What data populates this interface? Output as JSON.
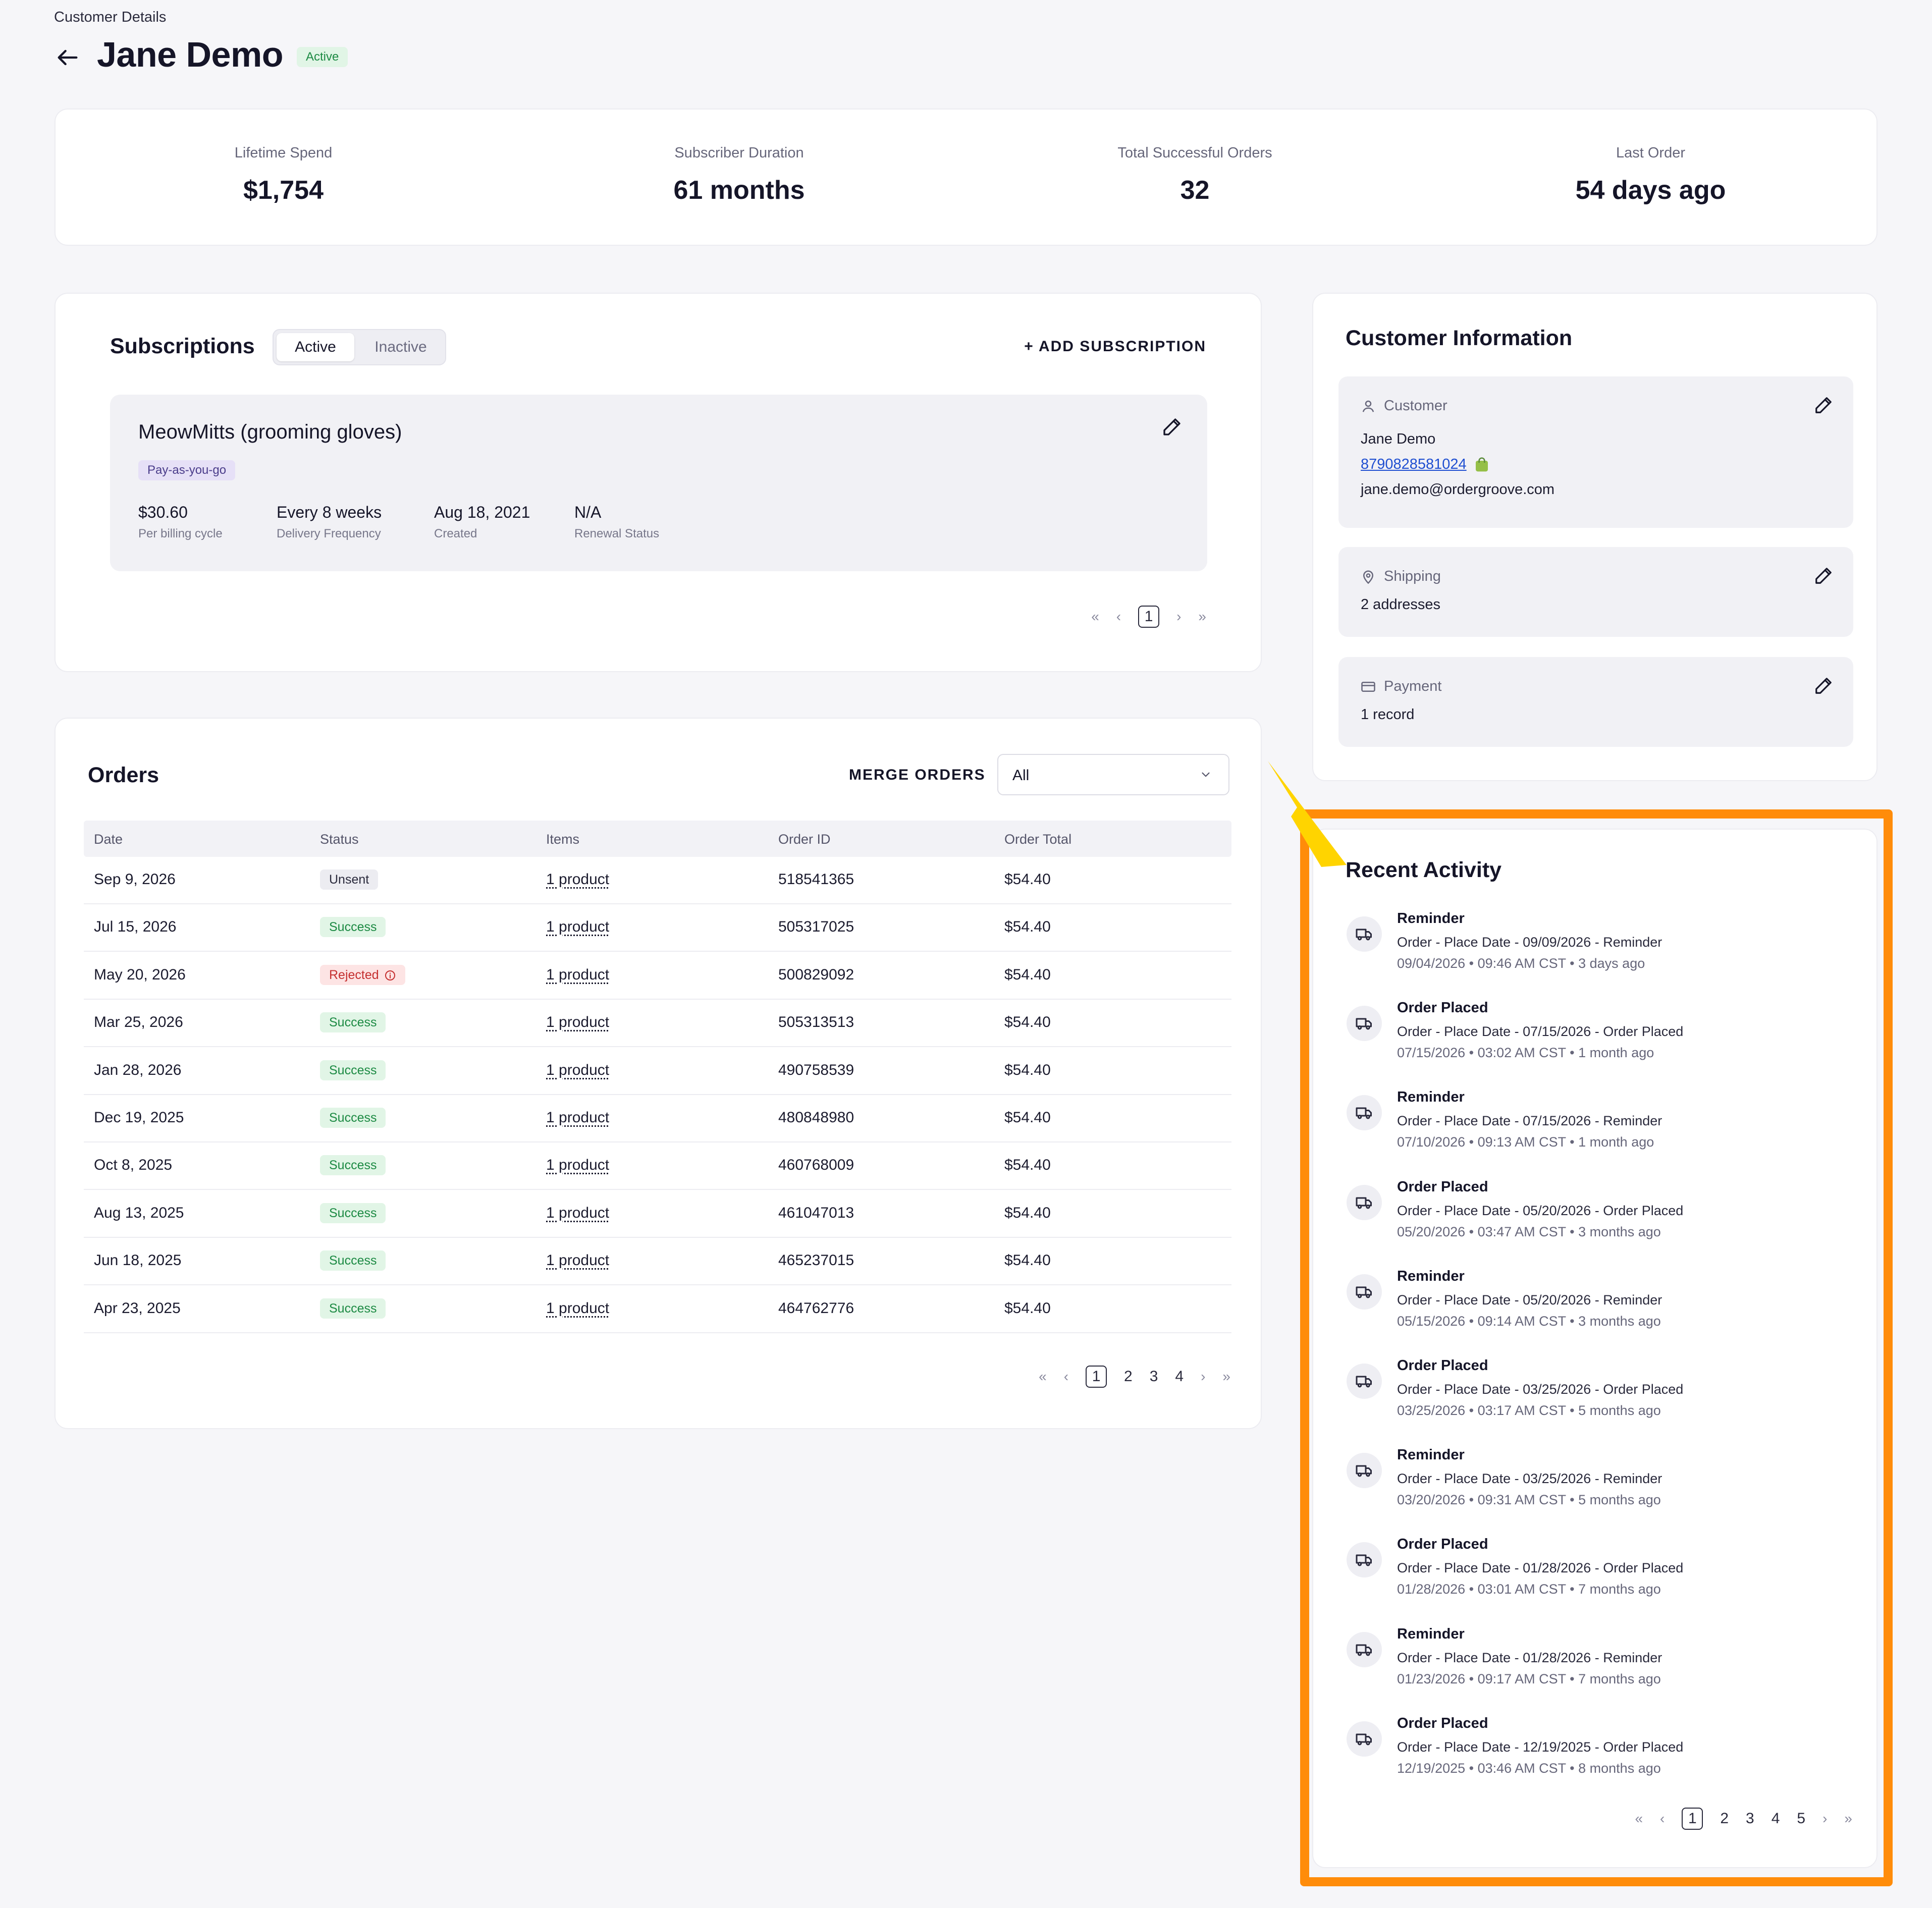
{
  "header": {
    "breadcrumb": "Customer Details",
    "title": "Jane Demo",
    "status": "Active"
  },
  "stats": [
    {
      "label": "Lifetime Spend",
      "value": "$1,754"
    },
    {
      "label": "Subscriber Duration",
      "value": "61 months"
    },
    {
      "label": "Total Successful Orders",
      "value": "32"
    },
    {
      "label": "Last Order",
      "value": "54 days ago"
    }
  ],
  "subscriptions": {
    "title": "Subscriptions",
    "tab_active": "Active",
    "tab_inactive": "Inactive",
    "add_label": "+ ADD SUBSCRIPTION",
    "item": {
      "name": "MeowMitts (grooming gloves)",
      "plan": "Pay-as-you-go",
      "fields": [
        {
          "value": "$30.60",
          "caption": "Per billing cycle"
        },
        {
          "value": "Every 8 weeks",
          "caption": "Delivery Frequency"
        },
        {
          "value": "Aug 18, 2021",
          "caption": "Created"
        },
        {
          "value": "N/A",
          "caption": "Renewal Status"
        }
      ]
    },
    "pager": {
      "first": "«",
      "prev": "‹",
      "current": "1",
      "next": "›",
      "last": "»"
    }
  },
  "orders": {
    "title": "Orders",
    "merge_label": "MERGE ORDERS",
    "filter_value": "All",
    "columns": [
      "Date",
      "Status",
      "Items",
      "Order ID",
      "Order Total"
    ],
    "rows": [
      {
        "date": "Sep 9, 2026",
        "status": "Unsent",
        "items": "1 product",
        "id": "518541365",
        "total": "$54.40"
      },
      {
        "date": "Jul 15, 2026",
        "status": "Success",
        "items": "1 product",
        "id": "505317025",
        "total": "$54.40"
      },
      {
        "date": "May 20, 2026",
        "status": "Rejected",
        "items": "1 product",
        "id": "500829092",
        "total": "$54.40"
      },
      {
        "date": "Mar 25, 2026",
        "status": "Success",
        "items": "1 product",
        "id": "505313513",
        "total": "$54.40"
      },
      {
        "date": "Jan 28, 2026",
        "status": "Success",
        "items": "1 product",
        "id": "490758539",
        "total": "$54.40"
      },
      {
        "date": "Dec 19, 2025",
        "status": "Success",
        "items": "1 product",
        "id": "480848980",
        "total": "$54.40"
      },
      {
        "date": "Oct 8, 2025",
        "status": "Success",
        "items": "1 product",
        "id": "460768009",
        "total": "$54.40"
      },
      {
        "date": "Aug 13, 2025",
        "status": "Success",
        "items": "1 product",
        "id": "461047013",
        "total": "$54.40"
      },
      {
        "date": "Jun 18, 2025",
        "status": "Success",
        "items": "1 product",
        "id": "465237015",
        "total": "$54.40"
      },
      {
        "date": "Apr 23, 2025",
        "status": "Success",
        "items": "1 product",
        "id": "464762776",
        "total": "$54.40"
      }
    ],
    "pager": {
      "first": "«",
      "prev": "‹",
      "pages": [
        "1",
        "2",
        "3",
        "4"
      ],
      "next": "›",
      "last": "»"
    }
  },
  "customer_info": {
    "title": "Customer Information",
    "customer": {
      "label": "Customer",
      "name": "Jane Demo",
      "phone": "8790828581024",
      "email": "jane.demo@ordergroove.com"
    },
    "shipping": {
      "label": "Shipping",
      "value": "2 addresses"
    },
    "payment": {
      "label": "Payment",
      "value": "1 record"
    }
  },
  "activity": {
    "title": "Recent Activity",
    "items": [
      {
        "title": "Reminder",
        "desc": "Order - Place Date - 09/09/2026 - Reminder",
        "time": "09/04/2026 • 09:46 AM CST • 3 days ago"
      },
      {
        "title": "Order Placed",
        "desc": "Order - Place Date - 07/15/2026 - Order Placed",
        "time": "07/15/2026 • 03:02 AM CST • 1 month ago"
      },
      {
        "title": "Reminder",
        "desc": "Order - Place Date - 07/15/2026 - Reminder",
        "time": "07/10/2026 • 09:13 AM CST • 1 month ago"
      },
      {
        "title": "Order Placed",
        "desc": "Order - Place Date - 05/20/2026 - Order Placed",
        "time": "05/20/2026 • 03:47 AM CST • 3 months ago"
      },
      {
        "title": "Reminder",
        "desc": "Order - Place Date - 05/20/2026 - Reminder",
        "time": "05/15/2026 • 09:14 AM CST • 3 months ago"
      },
      {
        "title": "Order Placed",
        "desc": "Order - Place Date - 03/25/2026 - Order Placed",
        "time": "03/25/2026 • 03:17 AM CST • 5 months ago"
      },
      {
        "title": "Reminder",
        "desc": "Order - Place Date - 03/25/2026 - Reminder",
        "time": "03/20/2026 • 09:31 AM CST • 5 months ago"
      },
      {
        "title": "Order Placed",
        "desc": "Order - Place Date - 01/28/2026 - Order Placed",
        "time": "01/28/2026 • 03:01 AM CST • 7 months ago"
      },
      {
        "title": "Reminder",
        "desc": "Order - Place Date - 01/28/2026 - Reminder",
        "time": "01/23/2026 • 09:17 AM CST • 7 months ago"
      },
      {
        "title": "Order Placed",
        "desc": "Order - Place Date - 12/19/2025 - Order Placed",
        "time": "12/19/2025 • 03:46 AM CST • 8 months ago"
      }
    ],
    "pager": {
      "first": "«",
      "prev": "‹",
      "pages": [
        "1",
        "2",
        "3",
        "4",
        "5"
      ],
      "next": "›",
      "last": "»"
    }
  },
  "colors": {
    "accent_highlight": "#ff8c0a",
    "pointer": "#ffd400",
    "success": "#1c8a43",
    "rejected": "#c53030",
    "link": "#1f4fd1"
  }
}
